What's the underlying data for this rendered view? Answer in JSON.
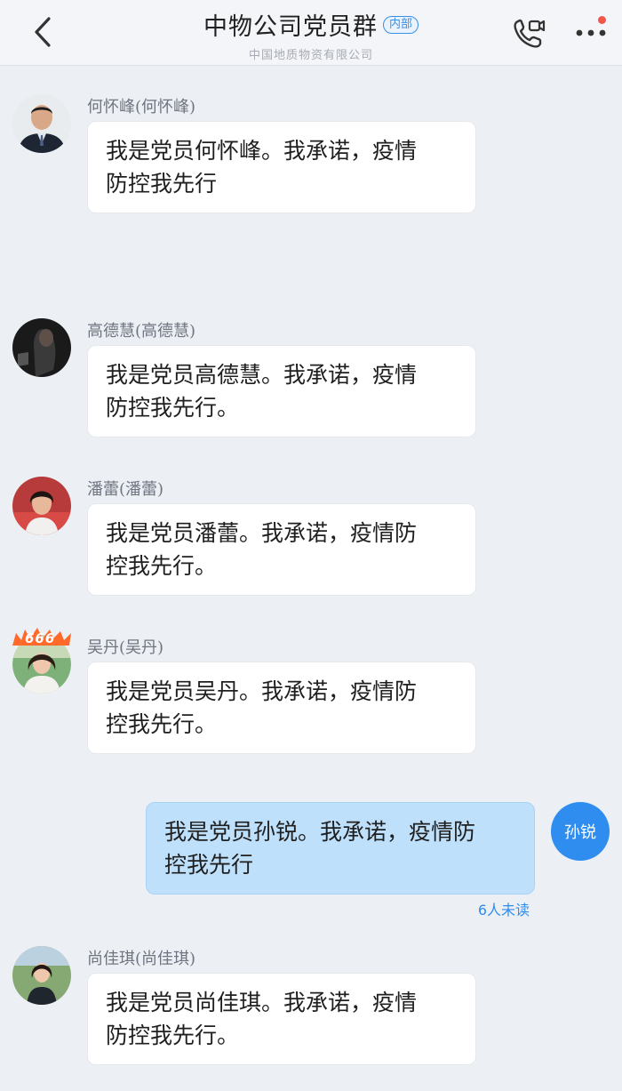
{
  "header": {
    "title": "中物公司党员群",
    "tag": "内部",
    "subtitle": "中国地质物资有限公司",
    "back_icon": "chevron-left-icon",
    "call_icon": "phone-video-icon",
    "more_icon": "more-dots-icon",
    "colors": {
      "accent": "#3a8ee6",
      "notify_dot": "#f2564a"
    }
  },
  "messages": [
    {
      "sender": "何怀峰(何怀峰)",
      "text_line1": "我是党员何怀峰。我承诺，疫情",
      "text_line2": "防控我先行"
    },
    {
      "sender": "高德慧(高德慧)",
      "text_line1": "我是党员高德慧。我承诺，疫情",
      "text_line2": "防控我先行。"
    },
    {
      "sender": "潘蕾(潘蕾)",
      "text_line1": "我是党员潘蕾。我承诺，疫情防",
      "text_line2": "控我先行。"
    },
    {
      "sender": "吴丹(吴丹)",
      "badge": "666",
      "text_line1": "我是党员吴丹。我承诺，疫情防",
      "text_line2": "控我先行。"
    },
    {
      "sender": "尚佳琪(尚佳琪)",
      "text_line1": "我是党员尚佳琪。我承诺，疫情",
      "text_line2": "防控我先行。"
    }
  ],
  "self_message": {
    "avatar_text": "孙锐",
    "text_line1": "我是党员孙锐。我承诺，疫情防",
    "text_line2": "控我先行",
    "read_status": "6人未读",
    "colors": {
      "bubble": "#bfe0fb",
      "avatar": "#2f8df0"
    }
  }
}
